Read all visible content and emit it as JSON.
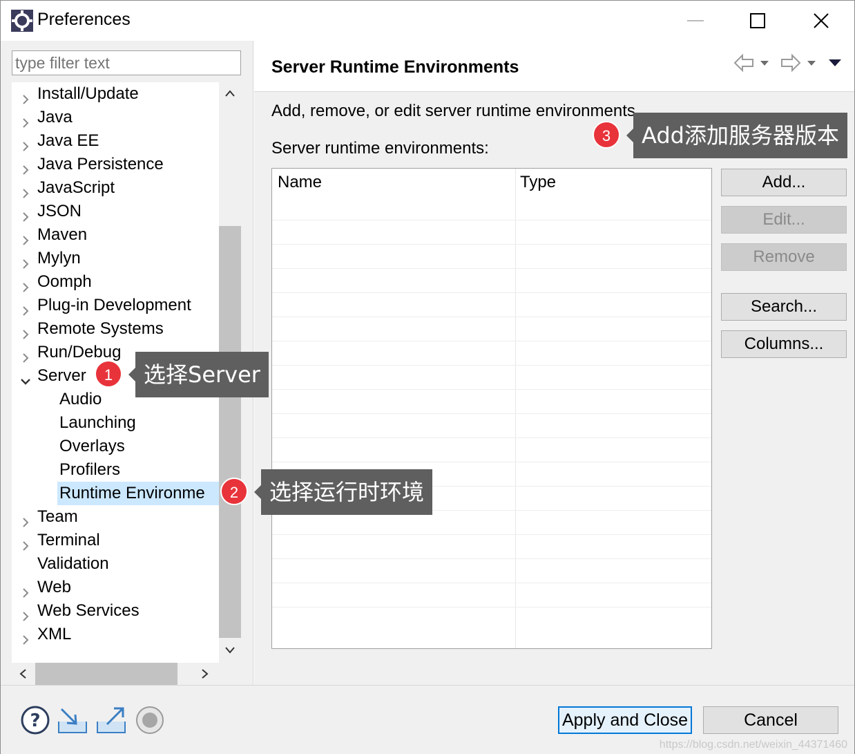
{
  "window": {
    "title": "Preferences",
    "colors": {
      "accent": "#0078d7",
      "selection": "#cce8ff",
      "badge": "#e8333a",
      "callout": "#5f5f5f"
    }
  },
  "filter": {
    "placeholder": "type filter text"
  },
  "tree": {
    "items": [
      {
        "label": "Install/Update",
        "expandable": true
      },
      {
        "label": "Java",
        "expandable": true
      },
      {
        "label": "Java EE",
        "expandable": true
      },
      {
        "label": "Java Persistence",
        "expandable": true
      },
      {
        "label": "JavaScript",
        "expandable": true
      },
      {
        "label": "JSON",
        "expandable": true
      },
      {
        "label": "Maven",
        "expandable": true
      },
      {
        "label": "Mylyn",
        "expandable": true
      },
      {
        "label": "Oomph",
        "expandable": true
      },
      {
        "label": "Plug-in Development",
        "expandable": true
      },
      {
        "label": "Remote Systems",
        "expandable": true
      },
      {
        "label": "Run/Debug",
        "expandable": true
      },
      {
        "label": "Server",
        "expandable": true,
        "expanded": true
      },
      {
        "label": "Audio",
        "child": true
      },
      {
        "label": "Launching",
        "child": true
      },
      {
        "label": "Overlays",
        "child": true
      },
      {
        "label": "Profilers",
        "child": true
      },
      {
        "label": "Runtime Environme",
        "child": true,
        "selected": true
      },
      {
        "label": "Team",
        "expandable": true
      },
      {
        "label": "Terminal",
        "expandable": true
      },
      {
        "label": "Validation",
        "expandable": false
      },
      {
        "label": "Web",
        "expandable": true
      },
      {
        "label": "Web Services",
        "expandable": true
      },
      {
        "label": "XML",
        "expandable": true
      }
    ]
  },
  "page": {
    "title": "Server Runtime Environments",
    "description": "Add, remove, or edit server runtime environments.",
    "list_label": "Server runtime environments:",
    "table": {
      "columns": [
        "Name",
        "Type"
      ],
      "rows": []
    },
    "buttons": {
      "add": "Add...",
      "edit": "Edit...",
      "remove": "Remove",
      "search": "Search...",
      "columns": "Columns..."
    }
  },
  "bottom": {
    "icons": [
      "help-icon",
      "import-icon",
      "export-icon",
      "record-icon"
    ],
    "apply_close": "Apply and Close",
    "cancel": "Cancel",
    "watermark": "https://blog.csdn.net/weixin_44371460"
  },
  "callouts": [
    {
      "number": "1",
      "text": "选择Server"
    },
    {
      "number": "2",
      "text": "选择运行时环境"
    },
    {
      "number": "3",
      "text": "Add添加服务器版本"
    }
  ]
}
